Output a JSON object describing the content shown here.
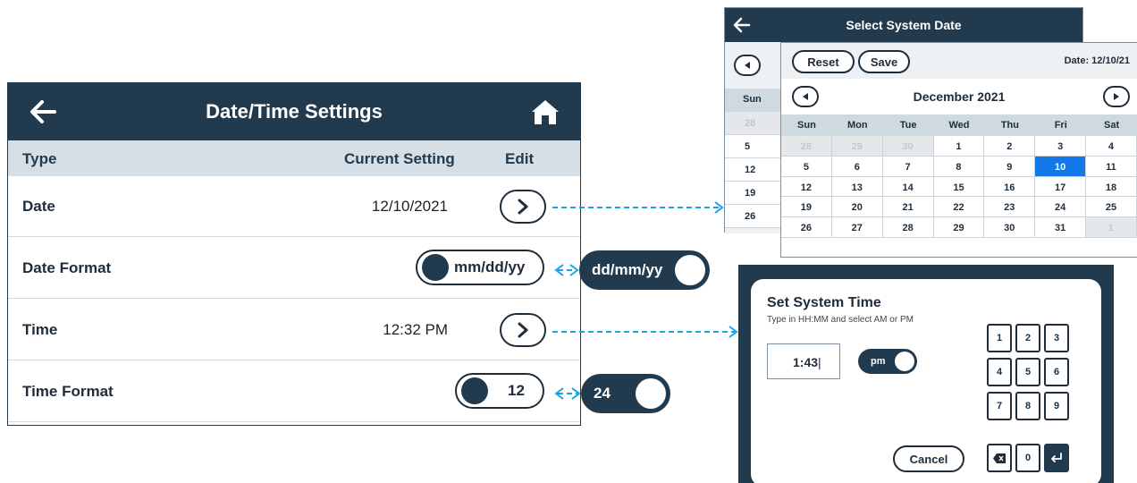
{
  "settings": {
    "title": "Date/Time Settings",
    "columns": {
      "type": "Type",
      "current": "Current Setting",
      "edit": "Edit"
    },
    "date": {
      "label": "Date",
      "value": "12/10/2021"
    },
    "date_format": {
      "label": "Date Format",
      "toggle_value": "mm/dd/yy",
      "alt_value": "dd/mm/yy"
    },
    "time": {
      "label": "Time",
      "value": "12:32 PM"
    },
    "time_format": {
      "label": "Time Format",
      "toggle_value": "12",
      "alt_value": "24"
    }
  },
  "date_picker": {
    "title": "Select System Date",
    "reset_label": "Reset",
    "save_label": "Save",
    "date_label": "Date: 12/10/21",
    "month": "December 2021",
    "weekdays": [
      "Sun",
      "Mon",
      "Tue",
      "Wed",
      "Thu",
      "Fri",
      "Sat"
    ],
    "back_strip": {
      "header": "Sun",
      "days": [
        "28",
        "5",
        "12",
        "19",
        "26"
      ]
    },
    "days": [
      {
        "d": "28",
        "dim": true
      },
      {
        "d": "29",
        "dim": true
      },
      {
        "d": "30",
        "dim": true
      },
      {
        "d": "1"
      },
      {
        "d": "2"
      },
      {
        "d": "3"
      },
      {
        "d": "4"
      },
      {
        "d": "5"
      },
      {
        "d": "6"
      },
      {
        "d": "7"
      },
      {
        "d": "8"
      },
      {
        "d": "9"
      },
      {
        "d": "10",
        "selected": true
      },
      {
        "d": "11"
      },
      {
        "d": "12"
      },
      {
        "d": "13"
      },
      {
        "d": "14"
      },
      {
        "d": "15"
      },
      {
        "d": "16"
      },
      {
        "d": "17"
      },
      {
        "d": "18"
      },
      {
        "d": "19"
      },
      {
        "d": "20"
      },
      {
        "d": "21"
      },
      {
        "d": "22"
      },
      {
        "d": "23"
      },
      {
        "d": "24"
      },
      {
        "d": "25"
      },
      {
        "d": "26"
      },
      {
        "d": "27"
      },
      {
        "d": "28"
      },
      {
        "d": "29"
      },
      {
        "d": "30"
      },
      {
        "d": "31"
      },
      {
        "d": "1",
        "dim": true
      }
    ]
  },
  "time_dialog": {
    "title": "Set System Time",
    "subtitle": "Type in HH:MM and select AM or PM",
    "input_value": "1:43",
    "ampm": "pm",
    "keys": [
      "1",
      "2",
      "3",
      "4",
      "5",
      "6",
      "7",
      "8",
      "9",
      "0"
    ],
    "cancel_label": "Cancel"
  },
  "colors": {
    "primary": "#223a4d",
    "selected": "#1478e8",
    "arrow": "#1aa3e0",
    "header_row": "#d6dfe6"
  }
}
